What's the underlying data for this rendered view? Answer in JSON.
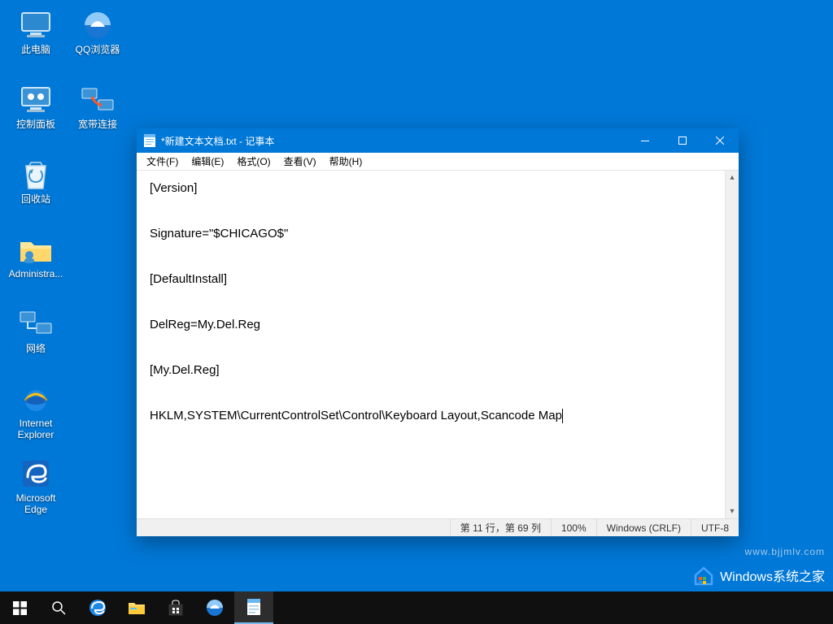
{
  "desktop": {
    "col0": [
      {
        "name": "pc-icon",
        "label": "此电脑"
      },
      {
        "name": "control-panel-icon",
        "label": "控制面板"
      },
      {
        "name": "recycle-bin-icon",
        "label": "回收站"
      },
      {
        "name": "admin-folder-icon",
        "label": "Administra..."
      },
      {
        "name": "network-icon",
        "label": "网络"
      },
      {
        "name": "ie-icon",
        "label": "Internet Explorer"
      },
      {
        "name": "edge-icon",
        "label": "Microsoft Edge"
      }
    ],
    "col1": [
      {
        "name": "qq-browser-icon",
        "label": "QQ浏览器"
      },
      {
        "name": "broadband-icon",
        "label": "宽带连接"
      }
    ]
  },
  "notepad": {
    "title": "*新建文本文档.txt - 记事本",
    "menu": [
      "文件(F)",
      "编辑(E)",
      "格式(O)",
      "查看(V)",
      "帮助(H)"
    ],
    "lines": [
      "[Version]",
      "",
      "Signature=\"$CHICAGO$\"",
      "",
      "[DefaultInstall]",
      "",
      "DelReg=My.Del.Reg",
      "",
      "[My.Del.Reg]",
      "",
      "HKLM,SYSTEM\\CurrentControlSet\\Control\\Keyboard Layout,Scancode Map"
    ],
    "status": {
      "position": "第 11 行，第 69 列",
      "zoom": "100%",
      "eol": "Windows (CRLF)",
      "encoding": "UTF-8"
    }
  },
  "taskbar": {
    "items": [
      {
        "name": "start-button"
      },
      {
        "name": "search-button"
      },
      {
        "name": "edge-taskbar"
      },
      {
        "name": "file-explorer-taskbar"
      },
      {
        "name": "store-taskbar"
      },
      {
        "name": "qq-browser-taskbar"
      },
      {
        "name": "notepad-taskbar",
        "active": true
      }
    ]
  },
  "watermark": {
    "brand": "Windows系统之家",
    "url": "www.bjjmlv.com"
  }
}
